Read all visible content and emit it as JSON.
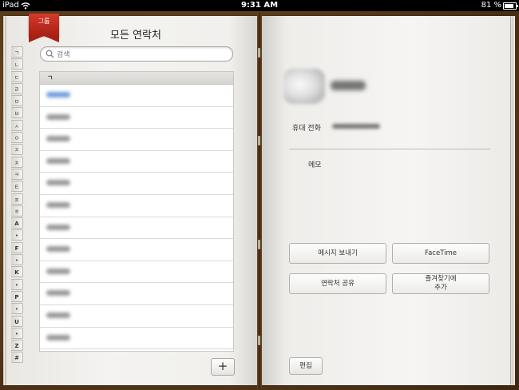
{
  "status_bar": {
    "device": "iPad",
    "time": "9:31 AM",
    "battery": "81 %",
    "battery_level": 0.81
  },
  "groups_button": "그룹",
  "left_page": {
    "title": "모든 연락처",
    "search": {
      "placeholder": "검색"
    },
    "index": [
      "ㄱ",
      "ㄴ",
      "ㄷ",
      "ㄹ",
      "ㅁ",
      "ㅂ",
      "ㅅ",
      "ㅇ",
      "ㅈ",
      "ㅊ",
      "ㅋ",
      "ㅌ",
      "ㅍ",
      "ㅎ",
      "A",
      "•",
      "F",
      "•",
      "K",
      "•",
      "P",
      "•",
      "U",
      "•",
      "Z",
      "#"
    ],
    "section_header": "ㄱ",
    "add_button": "+"
  },
  "right_page": {
    "phone_label": "휴대 전화",
    "memo_label": "메모",
    "actions": {
      "send_message": "메시지 보내기",
      "facetime": "FaceTime",
      "share_contact": "연락처 공유",
      "add_to_favorites_line1": "즐겨찾기에",
      "add_to_favorites_line2": "추가"
    },
    "edit_button": "편집"
  }
}
